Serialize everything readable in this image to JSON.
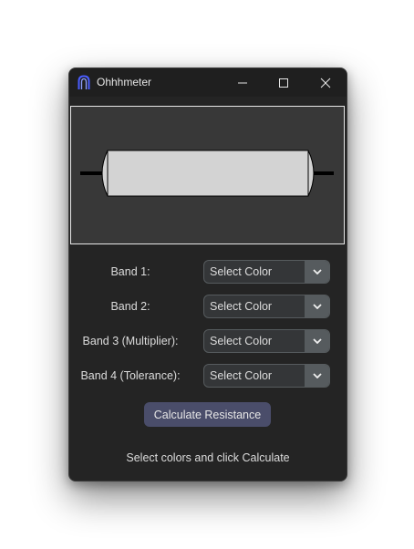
{
  "window": {
    "title": "Ohhhmeter",
    "icon": "app-logo-icon",
    "controls": {
      "minimize_icon": "minimize-icon",
      "maximize_icon": "maximize-icon",
      "close_icon": "close-icon"
    }
  },
  "colors": {
    "window_bg": "#242424",
    "titlebar_bg": "#1f1f1f",
    "canvas_bg": "#383838",
    "resistor_body": "#d3d3d3",
    "lead": "#000000",
    "dropdown_bg": "#343638",
    "dropdown_button": "#565b5e",
    "accent_button": "#4a4d6a",
    "app_icon": "#4a5cff"
  },
  "bands": [
    {
      "label": "Band 1:",
      "value": "Select Color"
    },
    {
      "label": "Band 2:",
      "value": "Select Color"
    },
    {
      "label": "Band 3 (Multiplier):",
      "value": "Select Color"
    },
    {
      "label": "Band 4 (Tolerance):",
      "value": "Select Color"
    }
  ],
  "dropdown_arrow_icon": "chevron-down-icon",
  "calculate_button": "Calculate Resistance",
  "status": "Select colors and click Calculate"
}
